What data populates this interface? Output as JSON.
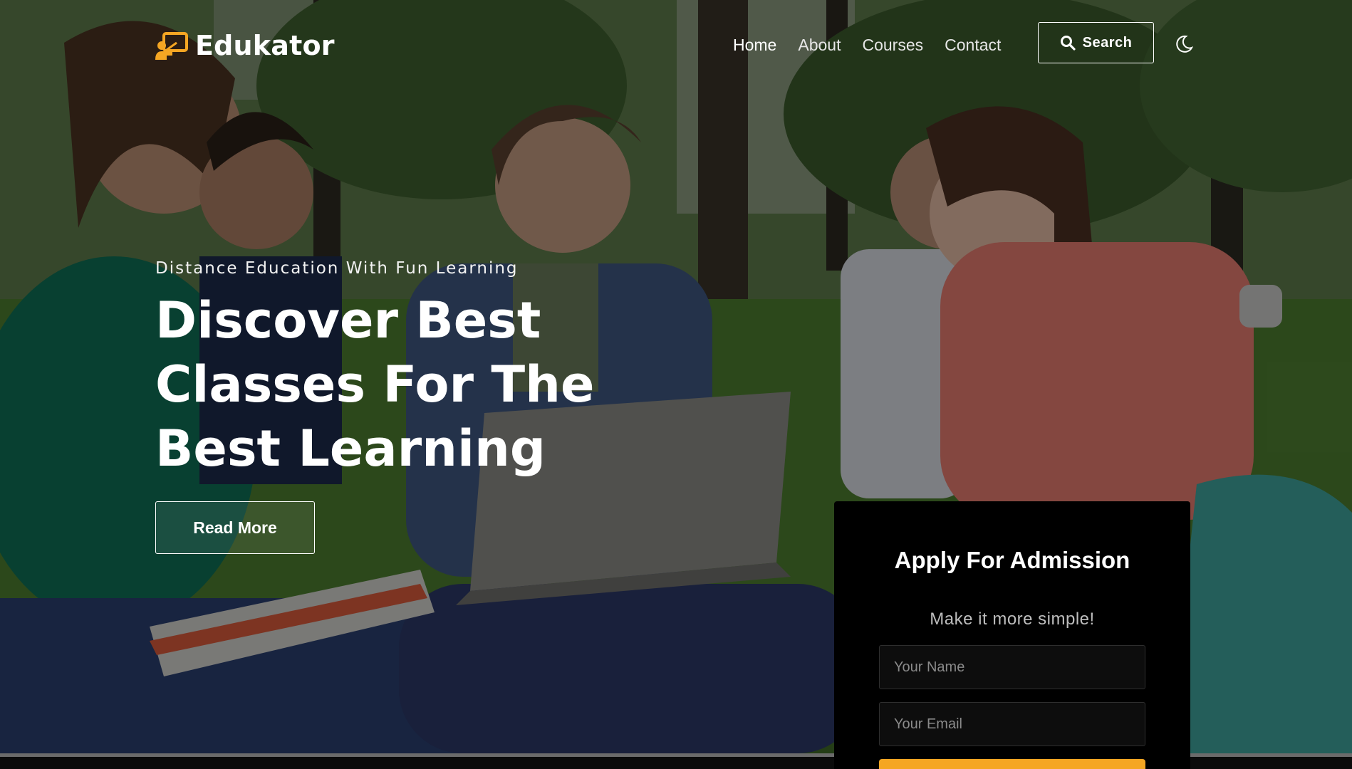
{
  "brand": {
    "name": "Edukator",
    "accent_color": "#f5a623",
    "logo_icon": "teacher-board-icon"
  },
  "nav": {
    "items": [
      {
        "label": "Home",
        "active": true
      },
      {
        "label": "About",
        "active": false
      },
      {
        "label": "Courses",
        "active": false
      },
      {
        "label": "Contact",
        "active": false
      }
    ],
    "search_label": "Search",
    "search_icon": "search-icon",
    "theme_icon": "moon-icon"
  },
  "hero": {
    "tagline": "Distance Education With Fun Learning",
    "headline": "Discover Best Classes For The Best Learning",
    "cta_label": "Read More",
    "background_image": "students-studying-in-park-photo"
  },
  "admission": {
    "title": "Apply For Admission",
    "subtitle": "Make it more simple!",
    "name_placeholder": "Your Name",
    "email_placeholder": "Your Email",
    "submit_color": "#f5a623"
  }
}
